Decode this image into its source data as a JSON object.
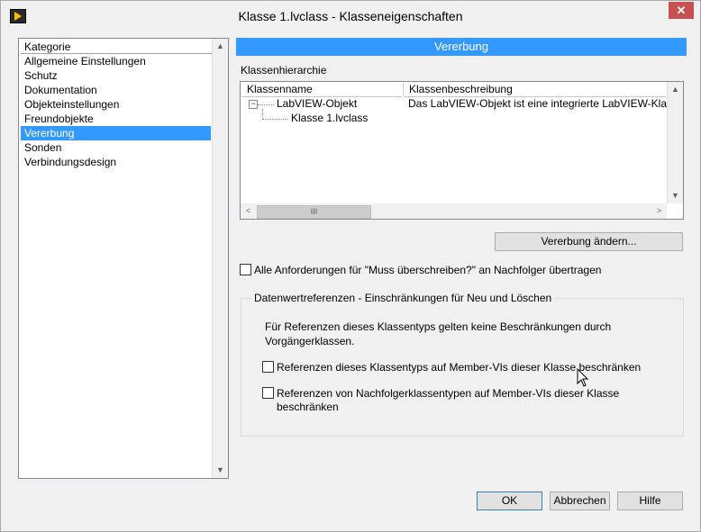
{
  "window": {
    "title": "Klasse 1.lvclass - Klasseneigenschaften",
    "close_glyph": "✕"
  },
  "sidebar": {
    "header": "Kategorie",
    "items": [
      {
        "label": "Allgemeine Einstellungen",
        "selected": false
      },
      {
        "label": "Schutz",
        "selected": false
      },
      {
        "label": "Dokumentation",
        "selected": false
      },
      {
        "label": "Objekteinstellungen",
        "selected": false
      },
      {
        "label": "Freundobjekte",
        "selected": false
      },
      {
        "label": "Vererbung",
        "selected": true
      },
      {
        "label": "Sonden",
        "selected": false
      },
      {
        "label": "Verbindungsdesign",
        "selected": false
      }
    ]
  },
  "main": {
    "section_title": "Vererbung",
    "hierarchy_label": "Klassenhierarchie",
    "hierarchy": {
      "columns": [
        "Klassenname",
        "Klassenbeschreibung"
      ],
      "rows": [
        {
          "name": "LabVIEW-Objekt",
          "description": "Das LabVIEW-Objekt ist eine integrierte LabVIEW-Klasse"
        },
        {
          "name": "Klasse 1.lvclass",
          "description": ""
        }
      ],
      "expander_glyph": "−",
      "hscroll_thumb_glyph": "III"
    },
    "change_inheritance_button": "Vererbung ändern...",
    "transfer_checkbox": {
      "label": "Alle Anforderungen für \"Muss überschreiben?\" an Nachfolger übertragen",
      "checked": false
    },
    "data_refs_group": {
      "title": "Datenwertreferenzen - Einschränkungen für Neu und Löschen",
      "info_line1": "Für Referenzen dieses Klassentyps gelten keine Beschränkungen durch",
      "info_line2": "Vorgängerklassen.",
      "checkbox1": {
        "label": "Referenzen dieses Klassentyps auf Member-VIs dieser Klasse beschränken",
        "checked": false
      },
      "checkbox2": {
        "label_line1": "Referenzen von Nachfolgerklassentypen auf Member-VIs dieser Klasse",
        "label_line2": "beschränken",
        "checked": false
      }
    }
  },
  "footer": {
    "ok": "OK",
    "cancel": "Abbrechen",
    "help": "Hilfe"
  },
  "scroll_glyphs": {
    "up": "▲",
    "down": "▼",
    "left": "<",
    "right": ">"
  }
}
